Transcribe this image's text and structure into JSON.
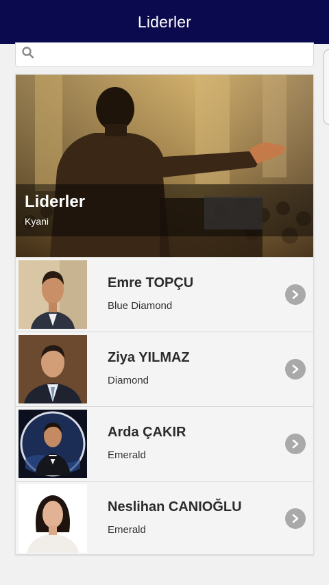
{
  "header": {
    "title": "Liderler"
  },
  "search": {
    "placeholder": "",
    "icon": "search-icon"
  },
  "hero": {
    "title": "Liderler",
    "subtitle": "Kyani"
  },
  "leaders": [
    {
      "name": "Emre TOPÇU",
      "rank": "Blue Diamond"
    },
    {
      "name": "Ziya YILMAZ",
      "rank": "Diamond"
    },
    {
      "name": "Arda ÇAKIR",
      "rank": "Emerald"
    },
    {
      "name": "Neslihan CANIOĞLU",
      "rank": "Emerald"
    }
  ],
  "colors": {
    "appbar": "#0b0a4e",
    "chevron": "#a9a9a9"
  }
}
